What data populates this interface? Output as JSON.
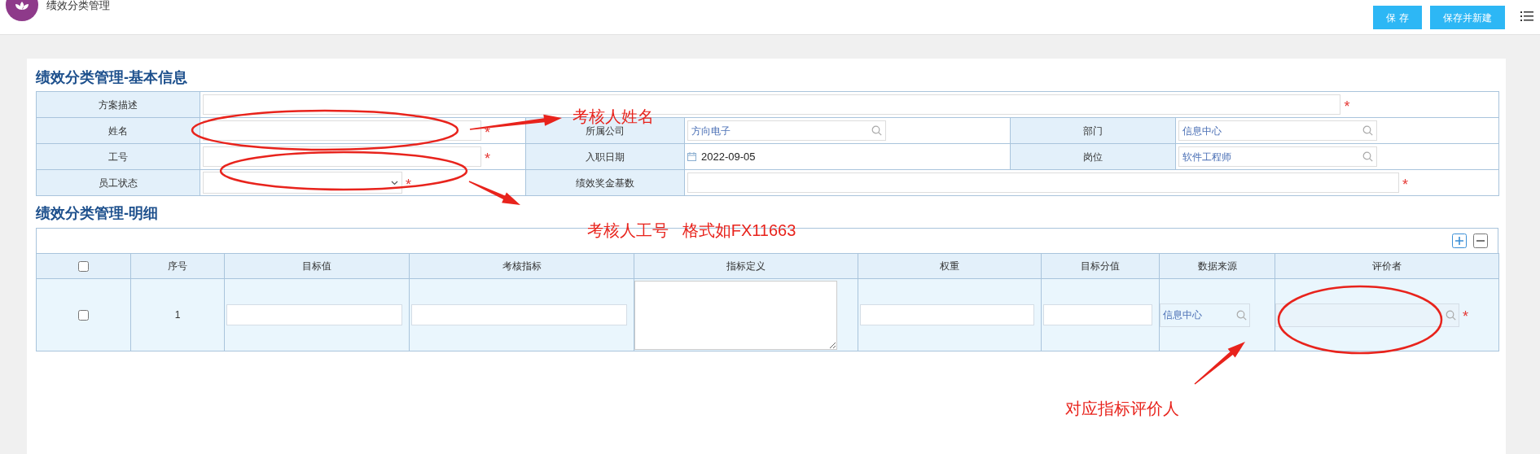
{
  "header": {
    "title": "绩效分类管理",
    "buttons": [
      "保 存",
      "保存并新建"
    ]
  },
  "basic_info": {
    "title": "绩效分类管理-基本信息",
    "rows": [
      [
        {
          "label": "方案描述",
          "kind": "text",
          "mark": "*"
        }
      ],
      [
        {
          "label": "姓名",
          "kind": "text",
          "mark": "*"
        },
        {
          "label": "所属公司",
          "kind": "lookup",
          "value": "方向电子"
        },
        {
          "label": "部门",
          "kind": "lookup",
          "value": "信息中心"
        }
      ],
      [
        {
          "label": "工号",
          "kind": "text",
          "mark": "*"
        },
        {
          "label": "入职日期",
          "kind": "date",
          "value": "2022-09-05"
        },
        {
          "label": "岗位",
          "kind": "lookup",
          "value": "软件工程师"
        }
      ],
      [
        {
          "label": "员工状态",
          "kind": "select",
          "mark": "*"
        },
        {
          "label": "绩效奖金基数",
          "kind": "text",
          "mark": "*"
        }
      ]
    ]
  },
  "detail": {
    "title": "绩效分类管理-明细",
    "columns": [
      {
        "kind": "checkbox",
        "checked": false
      },
      {
        "label": "序号",
        "kind": "index"
      },
      {
        "label": "目标值",
        "kind": "input"
      },
      {
        "label": "考核指标",
        "kind": "input"
      },
      {
        "label": "指标定义",
        "kind": "textarea"
      },
      {
        "label": "权重",
        "kind": "input"
      },
      {
        "label": "目标分值",
        "kind": "input"
      },
      {
        "label": "数据来源",
        "kind": "lookup"
      },
      {
        "label": "评价者",
        "kind": "lookup",
        "mark": "*"
      }
    ],
    "rows": [
      {
        "cells": [
          {
            "checked": false
          },
          {
            "text": "1"
          },
          {},
          {},
          {},
          {},
          {},
          {
            "value": "信息中心"
          },
          {}
        ]
      }
    ]
  },
  "annotations": [
    {
      "text": "考核人姓名"
    },
    {
      "text": "考核人工号   格式如FX11663"
    },
    {
      "text": "对应指标评价人"
    }
  ]
}
